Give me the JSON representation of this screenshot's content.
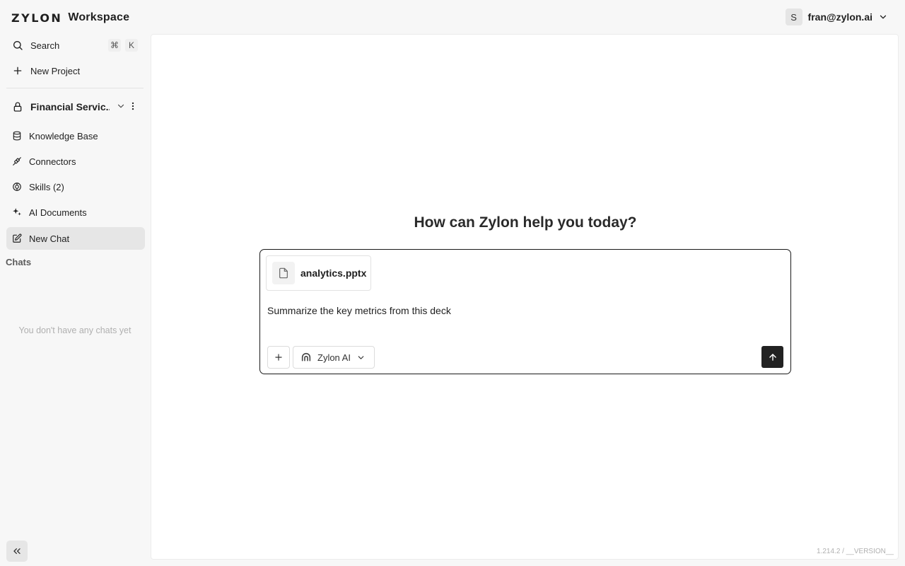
{
  "brand": {
    "logo": "ZYLON",
    "name": "Workspace"
  },
  "user": {
    "avatar_initial": "S",
    "email": "fran@zylon.ai"
  },
  "sidebar": {
    "search_label": "Search",
    "search_shortcut": [
      "⌘",
      "K"
    ],
    "new_project_label": "New Project",
    "project_name": "Financial Servic...",
    "items": [
      {
        "label": "Knowledge Base",
        "icon": "database-icon"
      },
      {
        "label": "Connectors",
        "icon": "plug-icon"
      },
      {
        "label": "Skills (2)",
        "icon": "skills-icon"
      },
      {
        "label": "AI Documents",
        "icon": "sparkles-icon"
      },
      {
        "label": "New Chat",
        "icon": "edit-icon",
        "active": true
      }
    ],
    "chats_label": "Chats",
    "empty_chats": "You don't have any chats yet"
  },
  "main": {
    "headline": "How can Zylon help you today?",
    "attachment": {
      "name": "analytics.pptx",
      "icon": "file-icon"
    },
    "prompt_value": "Summarize the key metrics from this deck",
    "model_label": "Zylon AI"
  },
  "version": "1.214.2 / __VERSION__"
}
